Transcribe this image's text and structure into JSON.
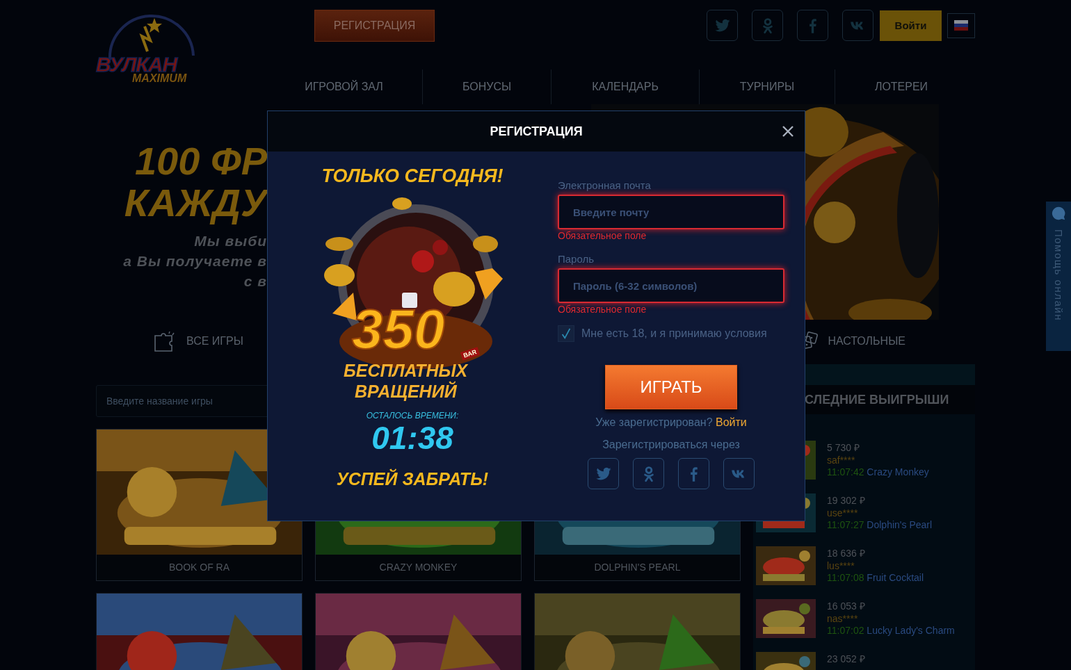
{
  "logo": {
    "title": "ВУЛКАН",
    "subtitle": "MAXIMUM"
  },
  "header": {
    "register_button": "РЕГИСТРАЦИЯ",
    "socials": [
      {
        "kind": "twitter"
      },
      {
        "kind": "ok"
      },
      {
        "kind": "facebook"
      },
      {
        "kind": "vk"
      }
    ],
    "login_button": "Войти"
  },
  "nav": [
    {
      "label": "ИГРОВОЙ ЗАЛ"
    },
    {
      "label": "БОНУСЫ"
    },
    {
      "label": "КАЛЕНДАРЬ"
    },
    {
      "label": "ТУРНИРЫ"
    },
    {
      "label": "ЛОТЕРЕИ"
    }
  ],
  "banner": {
    "title_lines": [
      "100 ФР",
      "КАЖДУ"
    ],
    "text_lines": [
      "Мы выби",
      "а Вы получаете в",
      "с в"
    ]
  },
  "categories": [
    {
      "label": "ВСЕ ИГРЫ",
      "kind": "puzzle"
    },
    {
      "label": "НАСТОЛЬНЫЕ",
      "kind": "dice"
    }
  ],
  "search": {
    "placeholder": "Введите название игры"
  },
  "games": [
    {
      "title": "BOOK OF RA"
    },
    {
      "title": "CRAZY MONKEY"
    },
    {
      "title": "DOLPHIN'S PEARL"
    },
    {
      "kind": "picture"
    },
    {
      "kind": "picture"
    },
    {
      "kind": "picture"
    }
  ],
  "wins": {
    "title": "СЛЕДНИЕ ВЫИГРЫШИ",
    "items": [
      {
        "amount": "5 730 ₽",
        "user": "saf****",
        "time": "11:07:42",
        "game": "Crazy Monkey"
      },
      {
        "amount": "19 302 ₽",
        "user": "use****",
        "time": "11:07:27",
        "game": "Dolphin's Pearl"
      },
      {
        "amount": "18 636 ₽",
        "user": "lus****",
        "time": "11:07:08",
        "game": "Fruit Cocktail"
      },
      {
        "amount": "16 053 ₽",
        "user": "nas****",
        "time": "11:07:02",
        "game": "Lucky Lady's Charm"
      },
      {
        "amount": "23 052 ₽"
      }
    ]
  },
  "help_tab": {
    "label": "Помощь онлайн"
  },
  "modal": {
    "title": "РЕГИСТРАЦИЯ",
    "promo": {
      "headline": "ТОЛЬКО СЕГОДНЯ!",
      "number": "350",
      "line_1": "БЕСПЛАТНЫХ",
      "line_2": "ВРАЩЕНИЙ",
      "badge": "BAR",
      "timer_label": "ОСТАЛОСЬ ВРЕМЕНИ:",
      "timer": "01:38",
      "cta": "УСПЕЙ ЗАБРАТЬ!"
    },
    "fields": [
      {
        "label": "Электронная почта",
        "placeholder": "Введите почту",
        "invalid": true,
        "error": "Обязательное поле"
      },
      {
        "label": "Пароль",
        "placeholder": "Пароль (6-32 символов)",
        "invalid": true,
        "error": "Обязательное поле"
      }
    ],
    "consent": {
      "checked": true,
      "label": "Мне есть 18, и я принимаю условия"
    },
    "play_button": "ИГРАТЬ",
    "login_prompt": "Уже зарегистрирован?",
    "login_link": "Войти",
    "social_label": "Зарегистрироваться через",
    "socials": [
      {
        "kind": "twitter"
      },
      {
        "kind": "ok"
      },
      {
        "kind": "facebook"
      },
      {
        "kind": "vk"
      }
    ]
  }
}
